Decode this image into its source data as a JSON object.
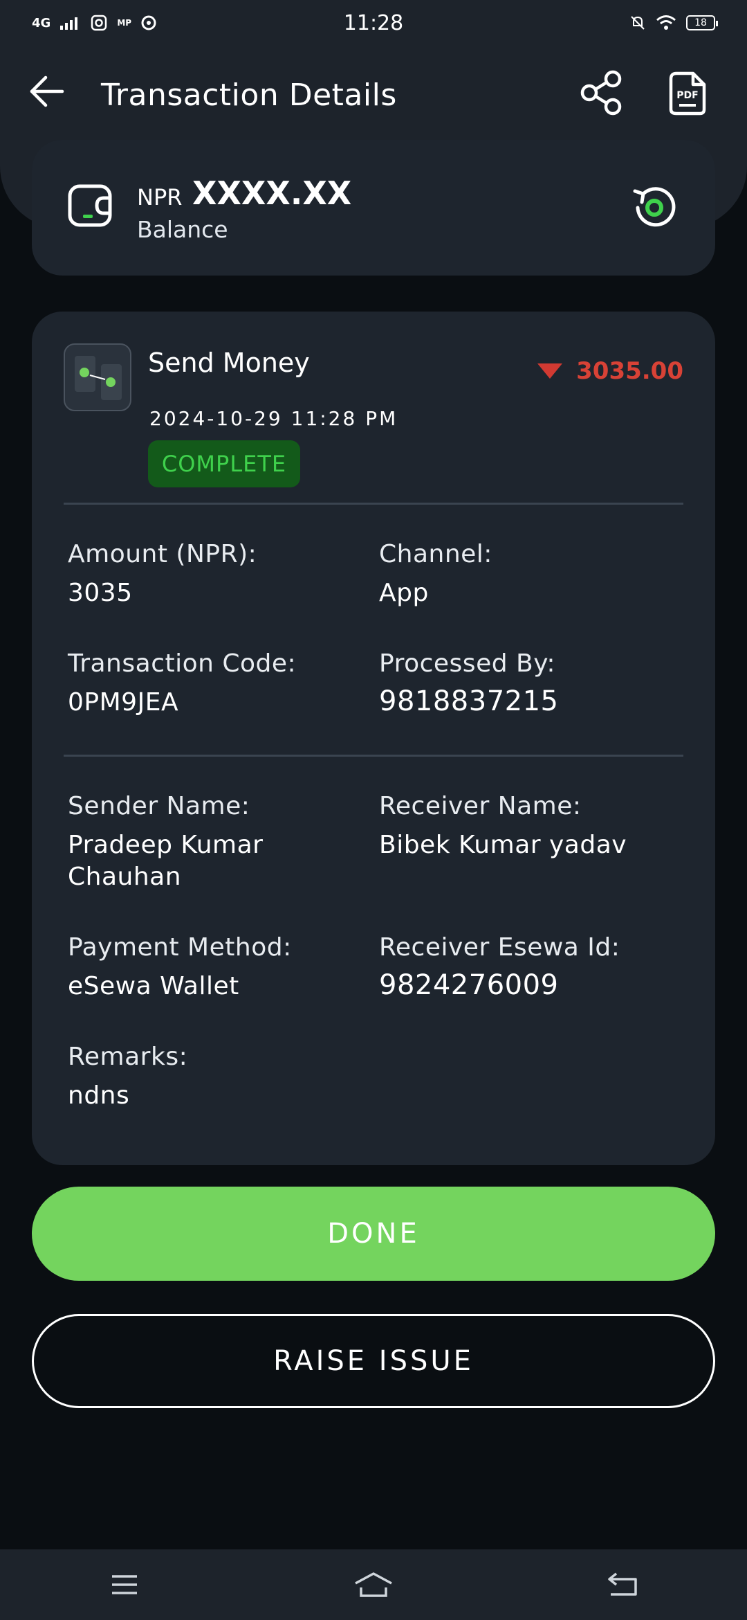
{
  "status_bar": {
    "network": "4G",
    "mp_label": "MP",
    "time": "11:28",
    "battery": "18"
  },
  "header": {
    "title": "Transaction Details",
    "icons": [
      "back-arrow-icon",
      "share-icon",
      "pdf-icon"
    ]
  },
  "balance": {
    "currency": "NPR",
    "amount": "XXXX.XX",
    "label": "Balance"
  },
  "transaction": {
    "type": "Send Money",
    "amount": "3035.00",
    "date": "2024-10-29 11:28 PM",
    "status": "COMPLETE"
  },
  "details": {
    "amount_label": "Amount (NPR):",
    "amount_value": "3035",
    "channel_label": "Channel:",
    "channel_value": "App",
    "code_label": "Transaction Code:",
    "code_value": "0PM9JEA",
    "processed_label": "Processed By:",
    "processed_value": "9818837215",
    "sender_label": "Sender Name:",
    "sender_value": "Pradeep Kumar Chauhan",
    "receiver_label": "Receiver Name:",
    "receiver_value": "Bibek Kumar yadav",
    "method_label": "Payment Method:",
    "method_value": "eSewa Wallet",
    "esewa_id_label": "Receiver Esewa Id:",
    "esewa_id_value": "9824276009",
    "remarks_label": "Remarks:",
    "remarks_value": "ndns"
  },
  "actions": {
    "done": "DONE",
    "raise_issue": "RAISE ISSUE"
  },
  "colors": {
    "accent_green": "#74d45e",
    "debit_red": "#d84236",
    "status_green": "#3fd14c"
  }
}
